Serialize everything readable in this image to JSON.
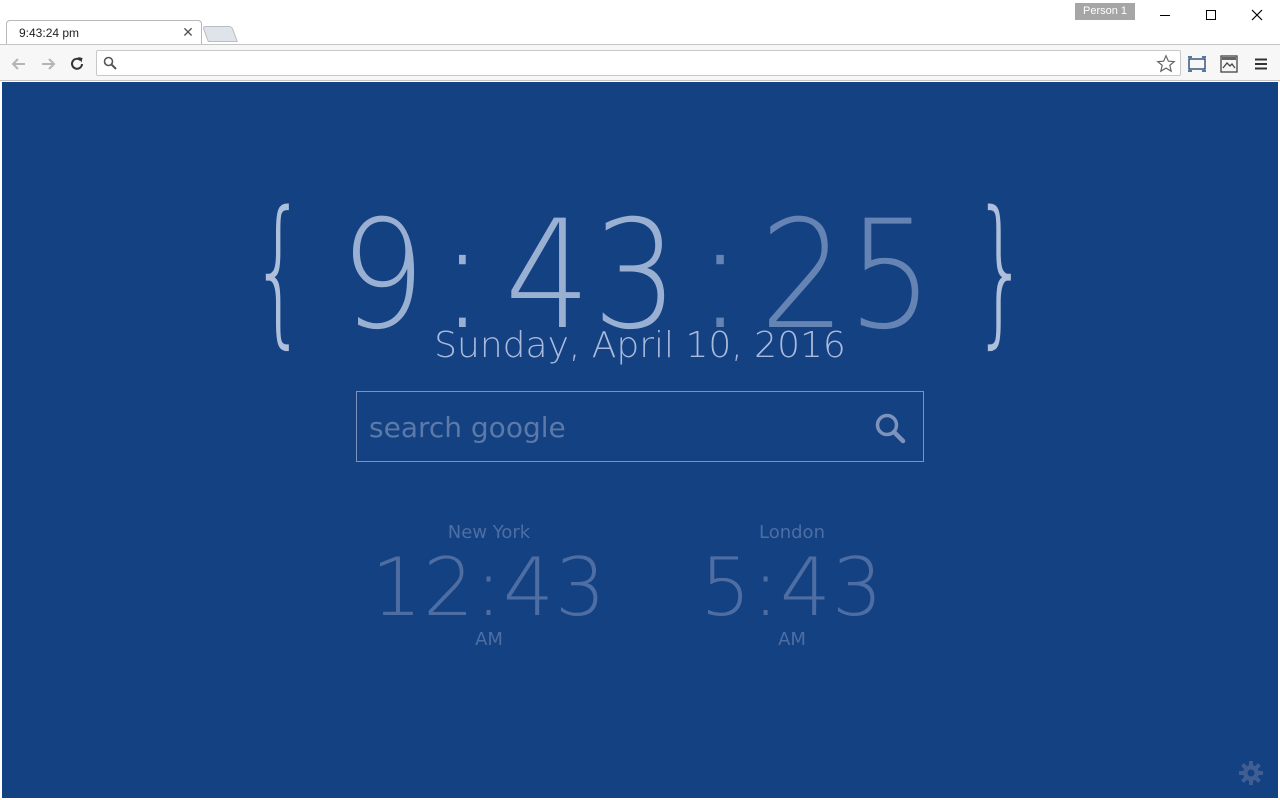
{
  "window": {
    "tab_title": "9:43:24 pm",
    "profile_label": "Person 1"
  },
  "toolbar": {
    "address_value": "",
    "address_placeholder": ""
  },
  "clock": {
    "left_brace": "{",
    "right_brace": "}",
    "hours": "9",
    "colon1": ":",
    "minutes": "43",
    "colon2": ":",
    "seconds": "25",
    "date": "Sunday, April 10, 2016"
  },
  "search": {
    "placeholder": "search google",
    "value": ""
  },
  "world_clocks": [
    {
      "city": "New York",
      "time": "12:43",
      "ampm": "AM"
    },
    {
      "city": "London",
      "time": "5:43",
      "ampm": "AM"
    }
  ],
  "colors": {
    "background": "#134182",
    "clock_primary": "#9ab0d2",
    "clock_secondary": "#6684b3",
    "world_clock_text": "#4e6ea3"
  },
  "icons": {
    "back": "arrow-left-icon",
    "forward": "arrow-right-icon",
    "reload": "reload-icon",
    "star": "star-icon",
    "menu": "hamburger-icon",
    "search": "search-icon",
    "settings": "gear-icon"
  }
}
